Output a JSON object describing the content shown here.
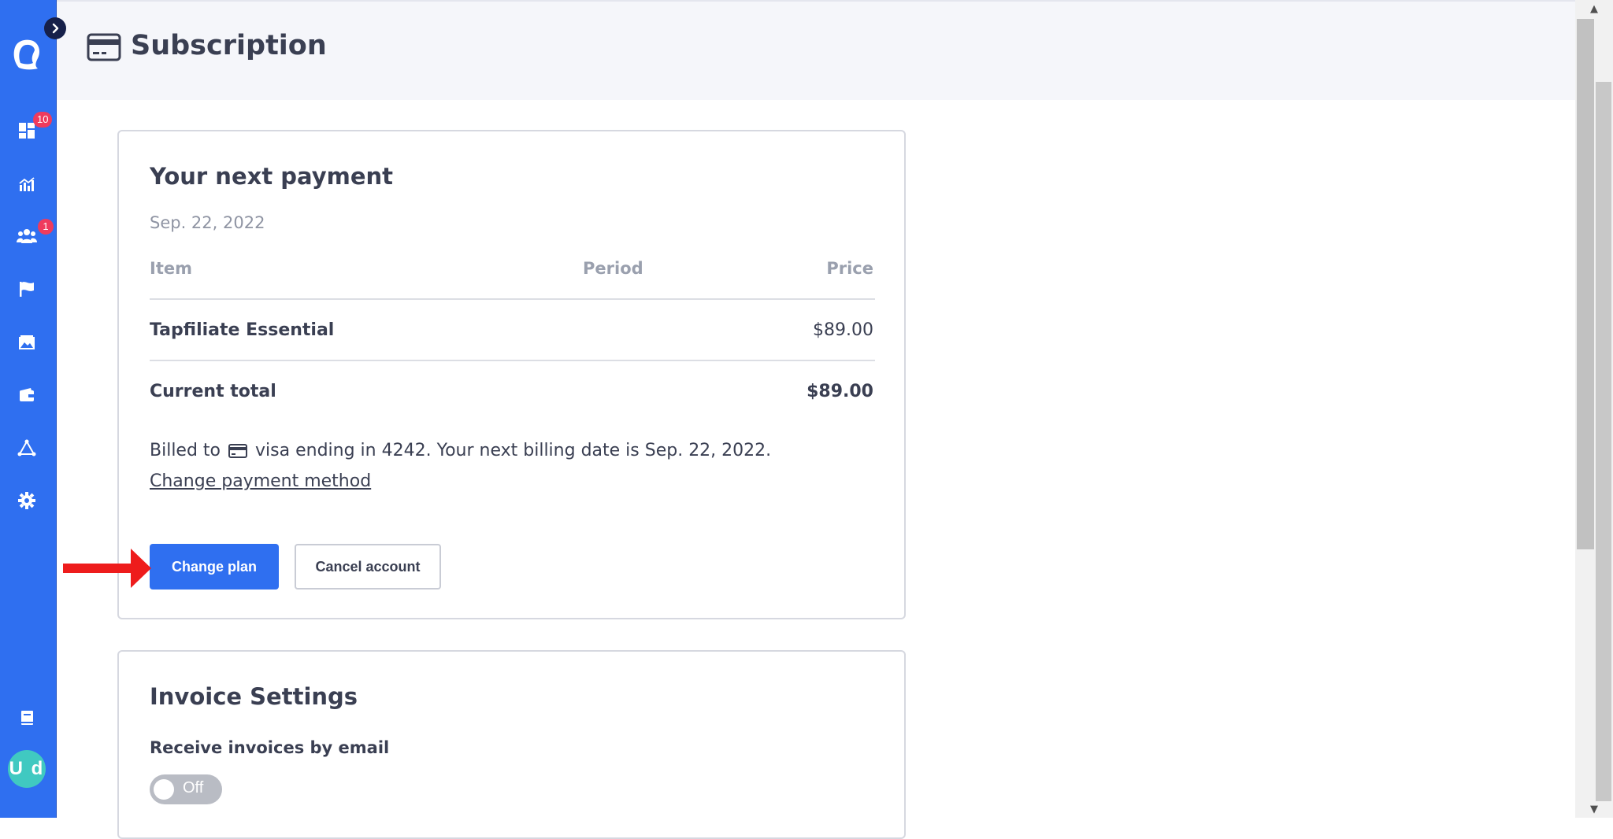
{
  "header": {
    "title": "Subscription",
    "icon": "credit-card-icon"
  },
  "sidebar": {
    "toggle_icon": "chevron-right-icon",
    "logo": "app-logo",
    "items": [
      {
        "name": "dashboard",
        "icon": "dashboard-grid-icon",
        "badge": "10"
      },
      {
        "name": "reports",
        "icon": "chart-icon",
        "badge": ""
      },
      {
        "name": "affiliates",
        "icon": "users-icon",
        "badge": "1"
      },
      {
        "name": "programs",
        "icon": "flag-icon",
        "badge": ""
      },
      {
        "name": "assets",
        "icon": "image-icon",
        "badge": ""
      },
      {
        "name": "payouts",
        "icon": "wallet-icon",
        "badge": ""
      },
      {
        "name": "integrations",
        "icon": "network-icon",
        "badge": ""
      },
      {
        "name": "settings",
        "icon": "gear-icon",
        "badge": ""
      },
      {
        "name": "docs",
        "icon": "book-icon",
        "badge": ""
      }
    ],
    "avatar_initials": "U d",
    "colors": {
      "background": "#2f6ff0",
      "badge": "#ef3b5d",
      "avatar": "#40c9c1"
    }
  },
  "payment": {
    "title": "Your next payment",
    "date": "Sep. 22, 2022",
    "columns": {
      "item": "Item",
      "period": "Period",
      "price": "Price"
    },
    "rows": [
      {
        "item": "Tapfiliate Essential",
        "period": "",
        "price": "$89.00"
      }
    ],
    "total_label": "Current total",
    "total_value": "$89.00",
    "billed_prefix": "Billed to",
    "billed_suffix": "visa ending in 4242. Your next billing date is Sep. 22, 2022.",
    "change_payment_link": "Change payment method",
    "change_plan_button": "Change plan",
    "cancel_button": "Cancel account"
  },
  "invoice": {
    "title": "Invoice Settings",
    "email_label": "Receive invoices by email",
    "toggle_state": "Off"
  },
  "accent": {
    "primary": "#2f6ff0",
    "arrow": "#ee1c1c"
  }
}
